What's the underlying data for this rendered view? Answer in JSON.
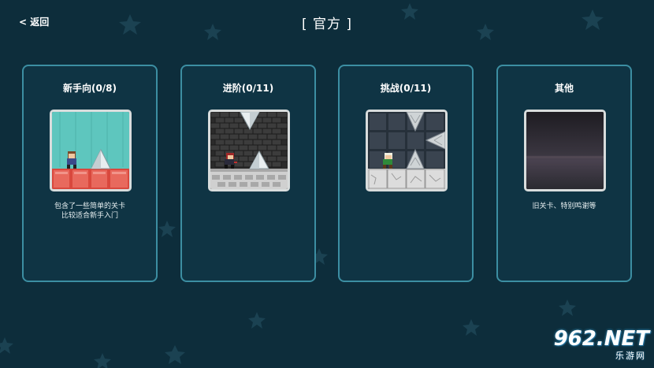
{
  "header": {
    "back_label": "< 返回",
    "title": "[ 官方 ]"
  },
  "cards": [
    {
      "title": "新手向(0/8)",
      "desc_lines": [
        "包含了一些简单的关卡",
        "比较适合新手入门"
      ]
    },
    {
      "title": "进阶(0/11)",
      "desc_lines": []
    },
    {
      "title": "挑战(0/11)",
      "desc_lines": []
    },
    {
      "title": "其他",
      "desc_lines": [
        "旧关卡、特别鸣谢等"
      ]
    }
  ],
  "watermark": {
    "main": "962.NET",
    "sub": "乐游网"
  },
  "colors": {
    "background": "#0d2d3b",
    "card_border": "#3c8ea2",
    "card_fill": "#0f3444",
    "star": "#1c4352"
  }
}
